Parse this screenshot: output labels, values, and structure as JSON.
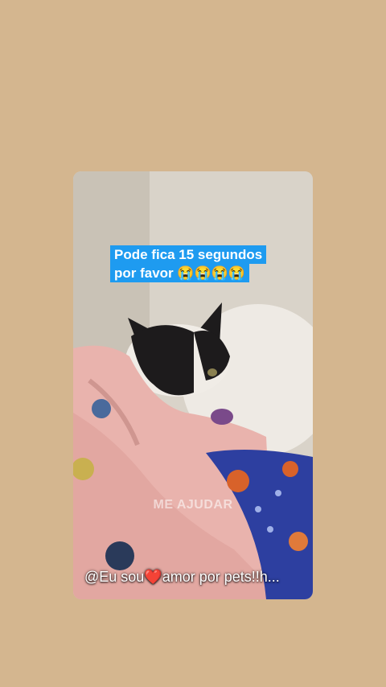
{
  "video": {
    "caption_line1": "Pode fica 15 segundos",
    "caption_line2": "por favor 😭😭😭😭",
    "watermark": "ME AJUDAR",
    "handle": "@Eu sou❤️amor por pets!!h..."
  },
  "colors": {
    "background": "#d4b68f",
    "caption_bg": "#1e9bf0"
  }
}
